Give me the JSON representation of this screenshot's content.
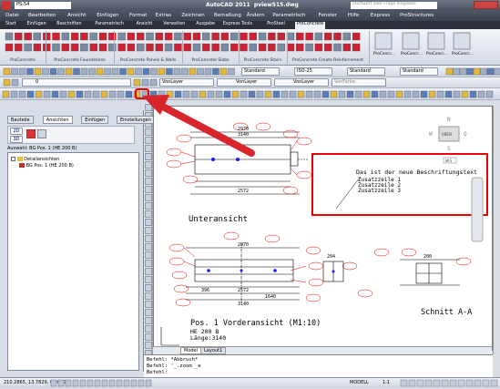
{
  "title": {
    "app": "AutoCAD 2011",
    "file": "pview515.dwg",
    "search_placeholder": "Stichwort oder Frage eingeben",
    "workspace": "PS-54"
  },
  "menu": [
    "Datei",
    "Bearbeiten",
    "Ansicht",
    "Einfügen",
    "Format",
    "Extras",
    "Zeichnen",
    "Bemaßung",
    "Ändern",
    "Parametrisch",
    "Fenster",
    "Hilfe",
    "Express",
    "ProStructures"
  ],
  "tabs": [
    "Start",
    "Einfügen",
    "Beschriften",
    "Parametrisch",
    "Ansicht",
    "Verwalten",
    "Ausgabe",
    "Express Tools",
    "ProSteel",
    "ProConcrete"
  ],
  "ribbon_groups": [
    "ProConcrete",
    "ProConcrete Foundations",
    "ProConcrete Panels & Walls",
    "ProConcrete Slabs",
    "ProConcrete Stairs",
    "ProConcrete Create Reinforcement"
  ],
  "ribbon_right": [
    "ProConcr...",
    "ProConcr...",
    "ProConcr...",
    "ProConcr..."
  ],
  "styles": {
    "text": "Standard",
    "dim": "ISO-25",
    "table": "Standard",
    "multileader": "Standard"
  },
  "layers": {
    "layer_num": "0",
    "color": "VonLayer",
    "linetype": "VonLayer",
    "lineweight": "VonLayer",
    "plot": "VonFarbe"
  },
  "panel": {
    "tabs": [
      "Bauteile",
      "Ansichten",
      "Einfügen",
      "Einstellungen"
    ],
    "view2d": "2D",
    "view3d": "3D",
    "selection": "Auswahl: BG Pos. 1 (HE 200 B)",
    "tree_root": "Detailansichten",
    "tree_child": "BG Pos. 1 (HE 200 B)"
  },
  "drawing": {
    "unteransicht": "Unteransicht",
    "vorderansicht": "Pos. 1 Vorderansicht (M1:10)",
    "profile": "HE 200 B",
    "laenge": "Länge:3140",
    "schnitt": "Schnitt A-A",
    "note_title": "Das ist der neue Beschriftungstext",
    "note_lines": [
      "Zusatzzeile 1",
      "Zusatzzeile 2",
      "Zusatzzeile 3"
    ],
    "dims": [
      "2970",
      "3140",
      "2572",
      "396",
      "1640",
      "204",
      "70",
      "200"
    ],
    "viewcube": "OBEN",
    "viewcube_dirs": [
      "N",
      "W",
      "O",
      "S"
    ],
    "wcs": "WKS"
  },
  "layout_tabs": [
    "Model",
    "Layout1"
  ],
  "commands": [
    "Befehl: *Abbruch*",
    "Befehl: '_.zoom _e",
    "Befehl:"
  ],
  "status": {
    "coords": "210.2865, 13.7829, 0.0000",
    "model": "MODELL",
    "scale": "1:1"
  },
  "colors": {
    "red": "#e00000",
    "highlight": "#d8242b"
  }
}
